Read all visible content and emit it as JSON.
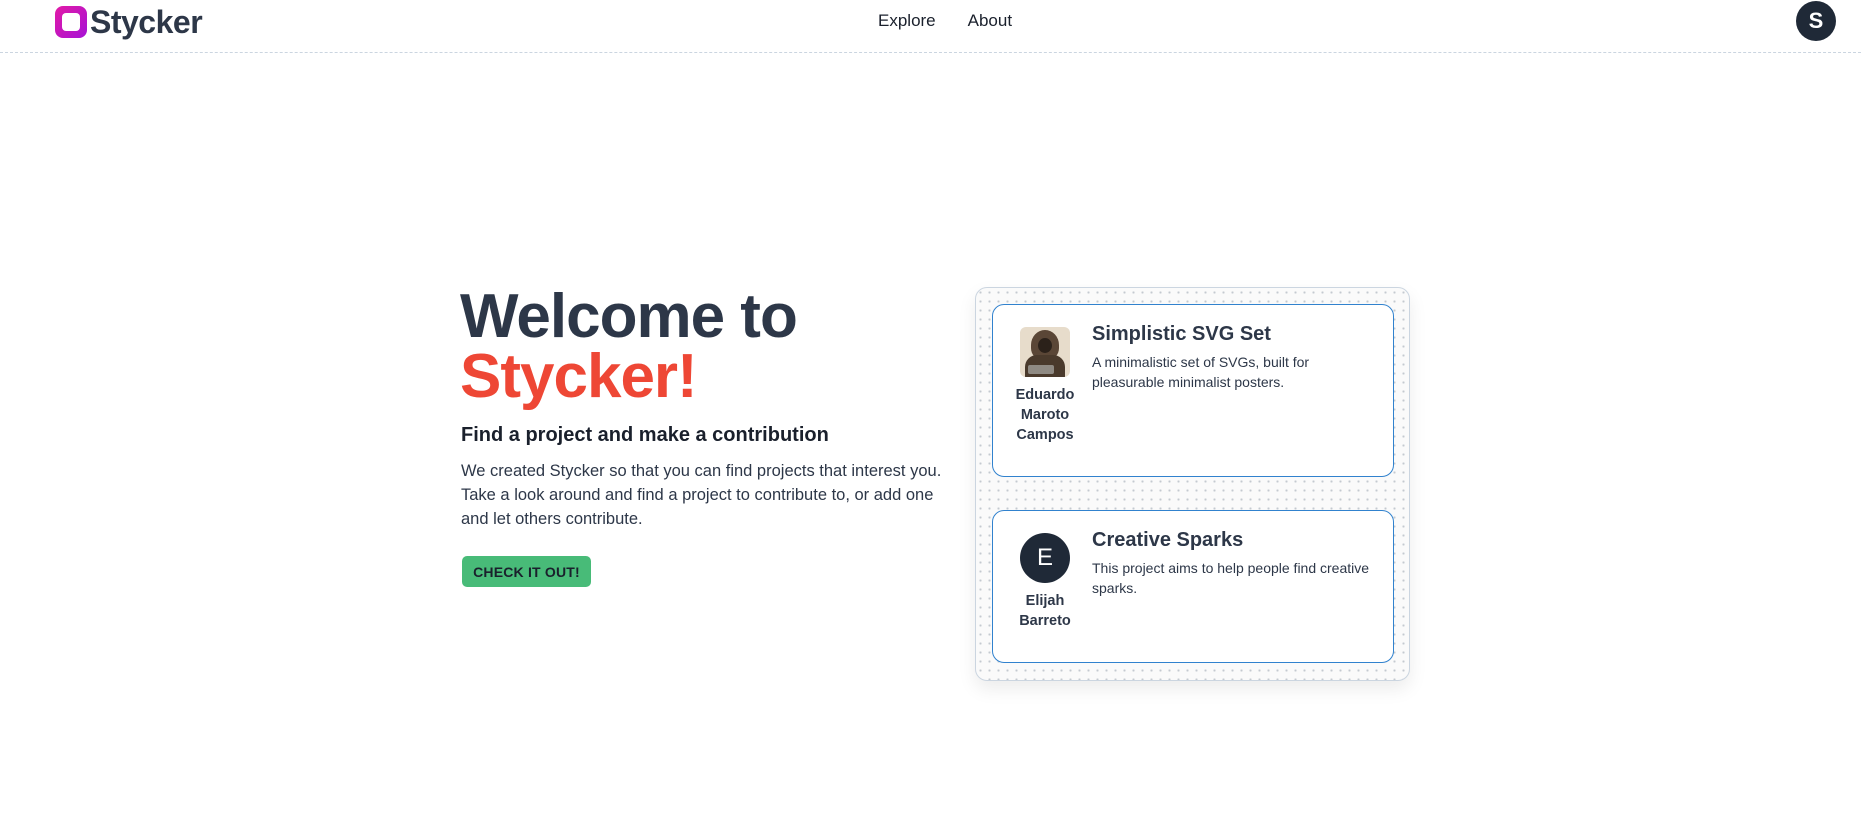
{
  "header": {
    "brand": "Stycker",
    "nav": [
      {
        "label": "Explore"
      },
      {
        "label": "About"
      }
    ],
    "user_initial": "S"
  },
  "hero": {
    "title_line1": "Welcome to",
    "title_line2": "Stycker!",
    "subtitle": "Find a project and make a contribution",
    "description": "We created Stycker so that you can find projects that interest you. Take a look around and find a project to contribute to, or add one and let others contribute.",
    "cta_label": "CHECK IT OUT!"
  },
  "projects": [
    {
      "title": "Simplistic SVG Set",
      "description": "A minimalistic set of SVGs, built for pleasurable minimalist posters.",
      "author": "Eduardo Maroto Campos",
      "avatar": "photo"
    },
    {
      "title": "Creative Sparks",
      "description": "This project aims to help people find creative sparks.",
      "author": "Elijah Barreto",
      "avatar_initial": "E"
    }
  ],
  "colors": {
    "accent": "#ee4735",
    "cta": "#48bb78",
    "card_border": "#3182ce",
    "brand_gradient_start": "#e21aa6",
    "brand_gradient_end": "#a612d6"
  }
}
